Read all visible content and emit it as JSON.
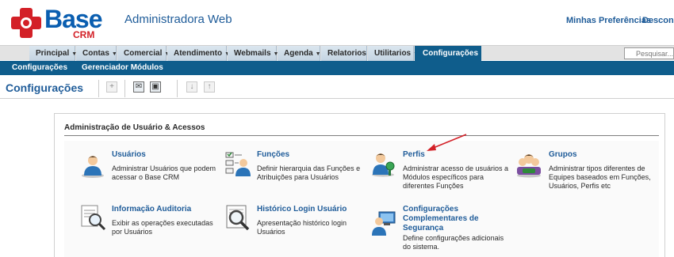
{
  "header": {
    "logo_main": "Base",
    "logo_sub": "CRM",
    "app_title": "Administradora Web",
    "links": [
      "Minhas Preferências",
      "Desconectar"
    ]
  },
  "main_menu": {
    "items": [
      "Principal",
      "Contas",
      "Comercial",
      "Atendimento",
      "Webmails",
      "Agenda",
      "Relatorios",
      "Utilitarios"
    ],
    "active": "Configurações",
    "search_placeholder": "Pesquisar..."
  },
  "sub_menu": {
    "items": [
      "Configurações",
      "Gerenciador Módulos"
    ]
  },
  "page": {
    "title": "Configurações"
  },
  "panel": {
    "title": "Administração de Usuário & Acessos",
    "cards": [
      {
        "title": "Usuários",
        "desc": [
          "Administrar Usuários que podem",
          "acessar o Base CRM"
        ],
        "icon": "user-icon"
      },
      {
        "title": "Funções",
        "desc": [
          "Definir hierarquia das Funções e",
          "Atribuições para Usuários"
        ],
        "icon": "roles-icon"
      },
      {
        "title": "Perfis",
        "desc": [
          "Administrar acesso de usuários a",
          "Módulos específicos para",
          "diferentes Funções"
        ],
        "icon": "profiles-icon"
      },
      {
        "title": "Grupos",
        "desc": [
          "Administrar tipos diferentes de",
          "Equipes baseados em Funções,",
          "Usuários, Perfis etc"
        ],
        "icon": "groups-icon"
      },
      {
        "title": "Informação Auditoria",
        "desc": [
          "Exibir as operações executadas",
          "por Usuários"
        ],
        "icon": "audit-icon"
      },
      {
        "title": "Histórico Login Usuário",
        "desc": [
          "Apresentação histórico login",
          "Usuários"
        ],
        "icon": "login-history-icon"
      },
      {
        "title": [
          "Configurações",
          "Complementares de",
          "Segurança"
        ],
        "desc": [
          "Define configurações adicionais",
          "do sistema."
        ],
        "icon": "security-settings-icon"
      }
    ]
  },
  "colors": {
    "brand_blue": "#0a5eb0",
    "brand_red": "#d32027",
    "nav_dark": "#0f5d8c",
    "link_blue": "#1f5c99"
  }
}
